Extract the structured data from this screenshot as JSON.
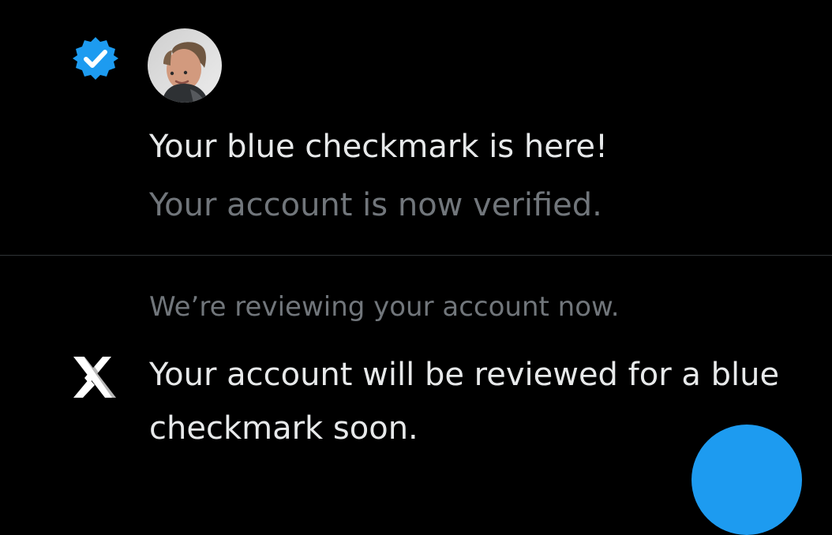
{
  "colors": {
    "background": "#000000",
    "primary_text": "#e7e9ea",
    "secondary_text": "#71767b",
    "divider": "#2f3336",
    "accent_blue": "#1d9bf0"
  },
  "notifications": [
    {
      "icon": "verified-badge-icon",
      "avatar": "user-avatar",
      "title": "Your blue checkmark is here!",
      "subtitle": "Your account is now verified."
    },
    {
      "icon": "x-logo-icon",
      "meta": "We’re reviewing your account now.",
      "message": "Your account will be reviewed for a blue checkmark soon."
    }
  ],
  "fab": {
    "icon": "compose-button"
  }
}
